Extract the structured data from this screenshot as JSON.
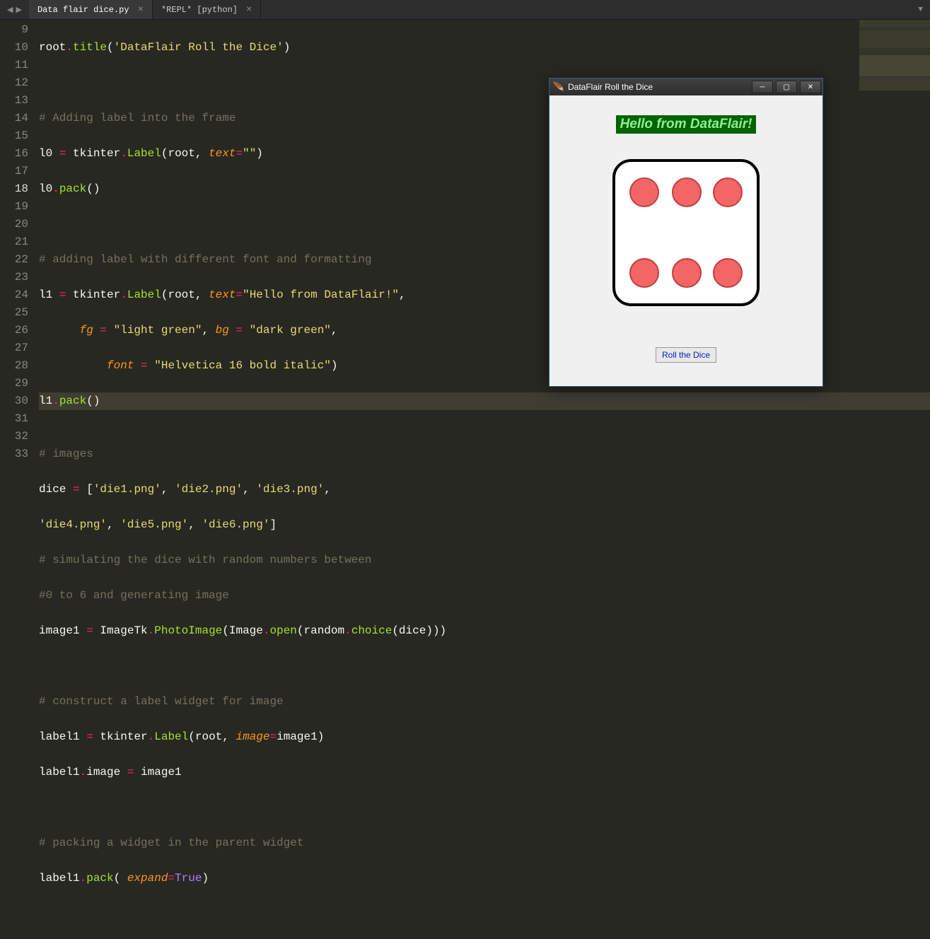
{
  "tabs": [
    {
      "label": "Data flair dice.py",
      "active": true
    },
    {
      "label": "*REPL* [python]",
      "active": false
    }
  ],
  "line_numbers": [
    "",
    "9",
    "10",
    "11",
    "12",
    "13",
    "14",
    "15",
    "16",
    "17",
    "18",
    "19",
    "20",
    "21",
    "22",
    "23",
    "24",
    "25",
    "26",
    "27",
    "28",
    "29",
    "30",
    "31",
    "32",
    "33"
  ],
  "current_line": "18",
  "code": {
    "l0": "root.title('DataFlair Roll the Dice')",
    "c1": "# Adding label into the frame",
    "l10a": "l0 ",
    "l10b": "=",
    "l10c": " tkinter",
    "l10d": ".",
    "l10e": "Label",
    "l10f": "(root, ",
    "l10g": "text",
    "l10h": "=",
    "l10i": "\"\"",
    "l10j": ")",
    "l11a": "l0",
    "l11b": ".",
    "l11c": "pack",
    "l11d": "()",
    "c2": "# adding label with different font and formatting",
    "l15a": "l1 ",
    "l15b": "=",
    "l15c": " tkinter",
    "l15d": ".",
    "l15e": "Label",
    "l15f": "(root, ",
    "l15g": "text",
    "l15h": "=",
    "l15i": "\"Hello from DataFlair!\"",
    "l15j": ",",
    "l16a": "      ",
    "l16b": "fg",
    "l16c": " = ",
    "l16d": "\"light green\"",
    "l16e": ", ",
    "l16f": "bg",
    "l16g": " = ",
    "l16h": "\"dark green\"",
    "l16i": ",",
    "l17a": "          ",
    "l17b": "font",
    "l17c": " = ",
    "l17d": "\"Helvetica 16 bold italic\"",
    "l17e": ")",
    "l18a": "l1",
    "l18b": ".",
    "l18c": "pack",
    "l18d": "()",
    "c3": "# images",
    "l21a": "dice ",
    "l21b": "=",
    "l21c": " [",
    "l21d": "'die1.png'",
    "l21e": ", ",
    "l21f": "'die2.png'",
    "l21g": ", ",
    "l21h": "'die3.png'",
    "l21i": ",",
    "l22a": "'die4.png'",
    "l22b": ", ",
    "l22c": "'die5.png'",
    "l22d": ", ",
    "l22e": "'die6.png'",
    "l22f": "]",
    "c4": "# simulating the dice with random numbers between",
    "c5": "#0 to 6 and generating image",
    "l25a": "image1 ",
    "l25b": "=",
    "l25c": " ImageTk",
    "l25d": ".",
    "l25e": "PhotoImage",
    "l25f": "(Image",
    "l25g": ".",
    "l25h": "open",
    "l25i": "(random",
    "l25j": ".",
    "l25k": "choice",
    "l25l": "(dice)))",
    "c6": "# construct a label widget for image",
    "l28a": "label1 ",
    "l28b": "=",
    "l28c": " tkinter",
    "l28d": ".",
    "l28e": "Label",
    "l28f": "(root, ",
    "l28g": "image",
    "l28h": "=",
    "l28i": "image1)",
    "l29a": "label1",
    "l29b": ".",
    "l29c": "image ",
    "l29d": "=",
    "l29e": " image1",
    "c7": "# packing a widget in the parent widget",
    "l32a": "label1",
    "l32b": ".",
    "l32c": "pack",
    "l32d": "( ",
    "l32e": "expand",
    "l32f": "=",
    "l32g": "True",
    "l32h": ")"
  },
  "tkwindow": {
    "title": "DataFlair Roll the Dice",
    "hello": "Hello from DataFlair!",
    "button": "Roll the Dice"
  }
}
